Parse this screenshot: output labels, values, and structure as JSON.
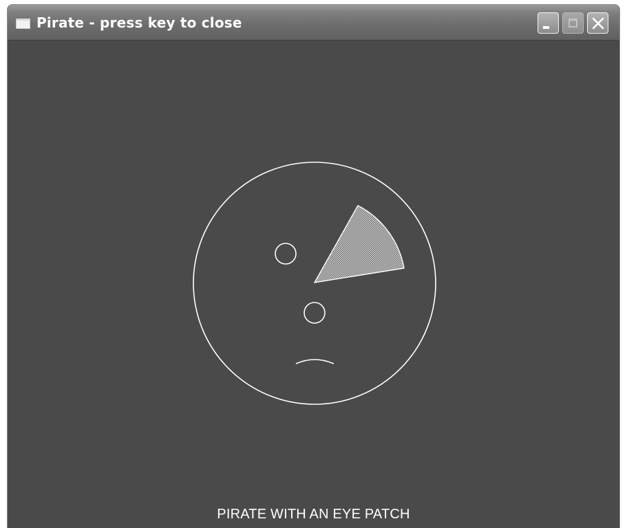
{
  "window": {
    "title": "Pirate - press key to close",
    "app_icon": "window-icon",
    "controls": {
      "minimize_icon": "minimize-icon",
      "maximize_icon": "maximize-icon",
      "close_icon": "close-icon"
    }
  },
  "drawing": {
    "caption": "PIRATE WITH AN EYE PATCH",
    "background_color": "#4a4a4a",
    "stroke_color": "#ffffff"
  }
}
